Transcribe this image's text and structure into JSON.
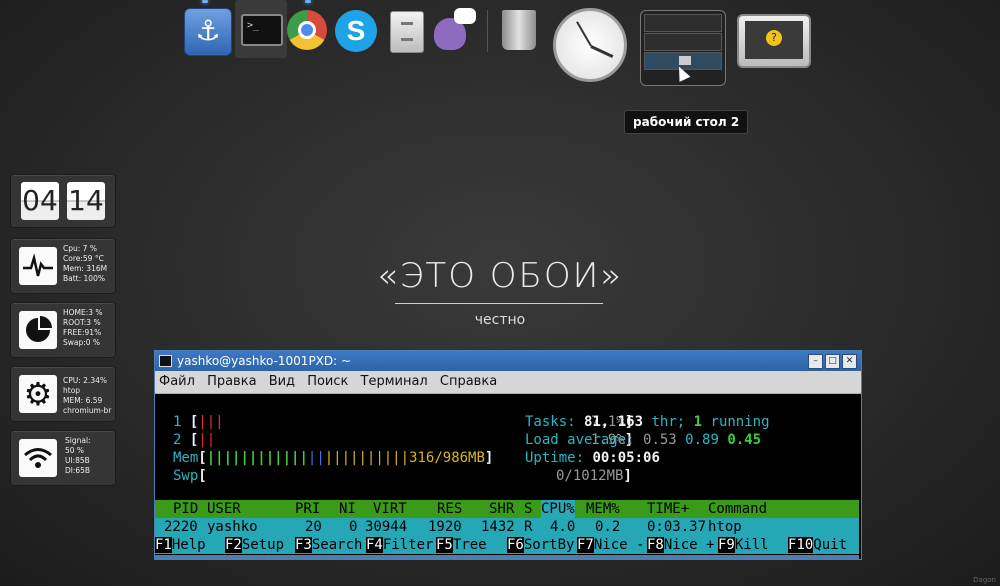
{
  "dock": {
    "items": [
      {
        "name": "anchor-app"
      },
      {
        "name": "terminal"
      },
      {
        "name": "chromium"
      },
      {
        "name": "skype"
      },
      {
        "name": "file-manager"
      },
      {
        "name": "pidgin"
      },
      {
        "name": "trash"
      },
      {
        "name": "clock"
      },
      {
        "name": "workspace-pager"
      },
      {
        "name": "system-monitor"
      }
    ],
    "anchor_glyph": "⚓",
    "skype_glyph": "S",
    "tooltip": "рабочий стол 2"
  },
  "widgets": {
    "clock": {
      "hours": "04",
      "minutes": "14"
    },
    "system": {
      "line1": "Cpu: 7 %",
      "line2": "Core:59 °C",
      "line3": "Mem: 316M",
      "line4": "Batt: 100%"
    },
    "disk": {
      "line1": "HOME:3 %",
      "line2": "ROOT:3 %",
      "line3": "FREE:91%",
      "line4": "Swap:0 %"
    },
    "process": {
      "line1": "CPU:  2.34%",
      "line2": "htop",
      "line3": "MEM:  6.59",
      "line4": "chromium-br"
    },
    "network": {
      "line1": "Signal:",
      "line2": "50  %",
      "line3": "Ul:85B",
      "line4": "Dl:65B"
    }
  },
  "wallpaper": {
    "title": "«ЭТО ОБОИ»",
    "subtitle": "честно"
  },
  "terminal": {
    "title": "yashko@yashko-1001PXD: ~",
    "menu": [
      "Файл",
      "Правка",
      "Вид",
      "Поиск",
      "Терминал",
      "Справка"
    ],
    "cpu1_label": "1",
    "cpu1_pct": "7.1%",
    "cpu2_label": "2",
    "cpu2_pct": "1.9%",
    "mem_label": "Mem",
    "mem_value": "316/986MB",
    "swp_label": "Swp",
    "swp_value": "0/1012MB",
    "tasks_label": "Tasks:",
    "tasks_count": "81",
    "threads_count": "163",
    "threads_label": "thr;",
    "running_count": "1",
    "running_label": "running",
    "load_label": "Load average:",
    "load1": "0.53",
    "load5": "0.89",
    "load15": "0.45",
    "uptime_label": "Uptime:",
    "uptime_value": "00:05:06",
    "header": {
      "pid": "PID",
      "user": "USER",
      "pri": "PRI",
      "ni": "NI",
      "virt": "VIRT",
      "res": "RES",
      "shr": "SHR",
      "s": "S",
      "cpu": "CPU%",
      "mem": "MEM%",
      "time": "TIME+",
      "command": "Command"
    },
    "process": {
      "pid": "2220",
      "user": "yashko",
      "pri": "20",
      "ni": "0",
      "virt": "30944",
      "res": "1920",
      "shr": "1432",
      "s": "R",
      "cpu": "4.0",
      "mem": "0.2",
      "time": "0:03.37",
      "command": "htop"
    },
    "fkeys": [
      {
        "key": "F1",
        "label": "Help"
      },
      {
        "key": "F2",
        "label": "Setup"
      },
      {
        "key": "F3",
        "label": "Search"
      },
      {
        "key": "F4",
        "label": "Filter"
      },
      {
        "key": "F5",
        "label": "Tree"
      },
      {
        "key": "F6",
        "label": "SortBy"
      },
      {
        "key": "F7",
        "label": "Nice -"
      },
      {
        "key": "F8",
        "label": "Nice +"
      },
      {
        "key": "F9",
        "label": "Kill"
      },
      {
        "key": "F10",
        "label": "Quit"
      }
    ]
  },
  "corner_text": "Dagon"
}
